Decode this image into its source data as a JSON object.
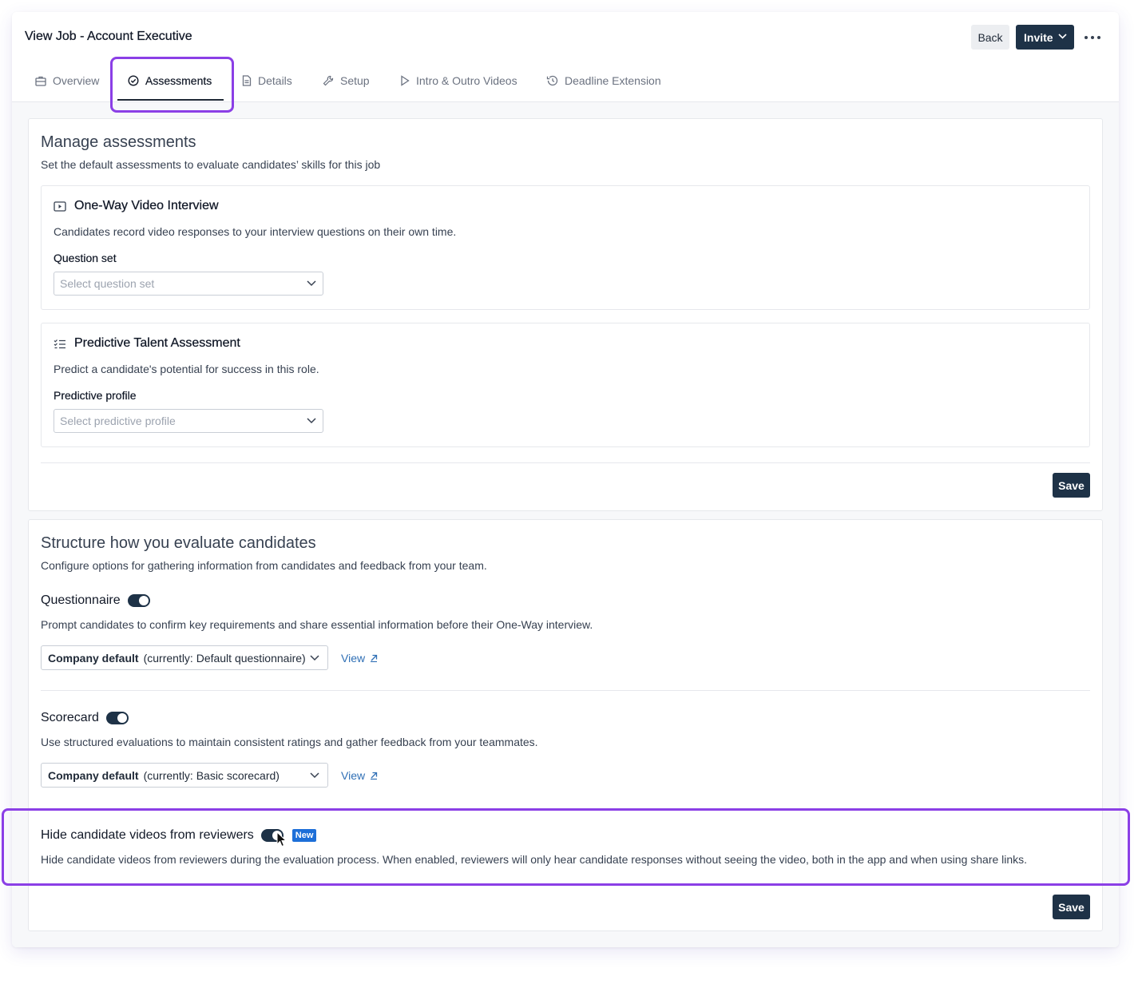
{
  "header": {
    "title": "View Job - Account Executive",
    "back_label": "Back",
    "invite_label": "Invite"
  },
  "tabs": [
    {
      "label": "Overview",
      "icon": "briefcase-icon"
    },
    {
      "label": "Assessments",
      "icon": "check-circle-icon",
      "active": true
    },
    {
      "label": "Details",
      "icon": "document-icon"
    },
    {
      "label": "Setup",
      "icon": "wrench-icon"
    },
    {
      "label": "Intro & Outro Videos",
      "icon": "play-icon"
    },
    {
      "label": "Deadline Extension",
      "icon": "history-icon"
    }
  ],
  "manage": {
    "title": "Manage assessments",
    "subtitle": "Set the default assessments to evaluate candidates’ skills for this job",
    "video": {
      "title": "One-Way Video Interview",
      "desc": "Candidates record video responses to your interview questions on their own time.",
      "field_label": "Question set",
      "placeholder": "Select question set"
    },
    "predictive": {
      "title": "Predictive Talent Assessment",
      "desc": "Predict a candidate's potential for success in this role.",
      "field_label": "Predictive profile",
      "placeholder": "Select predictive profile"
    },
    "save_label": "Save"
  },
  "structure": {
    "title": "Structure how you evaluate candidates",
    "subtitle": "Configure options for gathering information from candidates and feedback from your team.",
    "questionnaire": {
      "title": "Questionnaire",
      "enabled": true,
      "desc": "Prompt candidates to confirm key requirements and share essential information before their One-Way interview.",
      "select_bold": "Company default",
      "select_rest": "(currently: Default questionnaire)",
      "view_label": "View"
    },
    "scorecard": {
      "title": "Scorecard",
      "enabled": true,
      "desc": "Use structured evaluations to maintain consistent ratings and gather feedback from your teammates.",
      "select_bold": "Company default",
      "select_rest": "(currently: Basic scorecard)",
      "view_label": "View"
    },
    "hide_videos": {
      "title": "Hide candidate videos from reviewers",
      "enabled": true,
      "badge": "New",
      "desc": "Hide candidate videos from reviewers during the evaluation process. When enabled, reviewers will only hear candidate responses without seeing the video, both in the app and when using share links."
    },
    "save_label": "Save"
  },
  "colors": {
    "primary": "#1e3247",
    "highlight": "#8b3fe6",
    "link": "#2f6fb5",
    "badge": "#1d6fd8"
  }
}
